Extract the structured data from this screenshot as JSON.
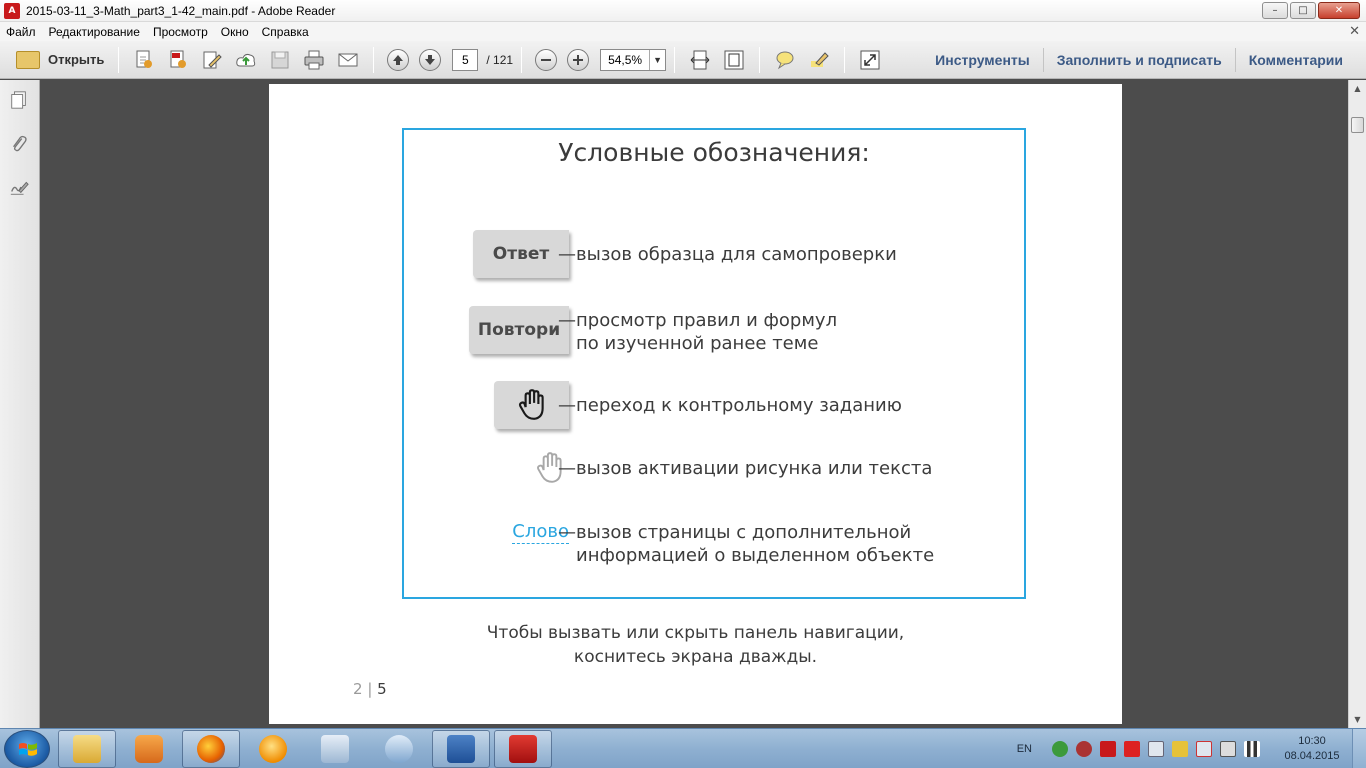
{
  "window": {
    "title": "2015-03-11_3-Math_part3_1-42_main.pdf - Adobe Reader",
    "controls": {
      "minimize": "–",
      "maximize": "□",
      "close": "✕"
    }
  },
  "menubar": {
    "items": [
      "Файл",
      "Редактирование",
      "Просмотр",
      "Окно",
      "Справка"
    ],
    "close_glyph": "✕"
  },
  "toolbar": {
    "open_label": "Открыть",
    "page_current": "5",
    "page_total": "/ 121",
    "zoom": "54,5%",
    "panes": [
      "Инструменты",
      "Заполнить и подписать",
      "Комментарии"
    ]
  },
  "page": {
    "legend_title": "Условные обозначения:",
    "rows": [
      {
        "key": "Ответ",
        "dash": "—",
        "lines": [
          "вызов образца для самопроверки"
        ]
      },
      {
        "key": "Повтори",
        "dash": "—",
        "lines": [
          "просмотр правил и формул",
          "по изученной ранее теме"
        ]
      },
      {
        "key": "hand-dark-icon",
        "dash": "—",
        "lines": [
          "переход к контрольному заданию"
        ]
      },
      {
        "key": "hand-light-icon",
        "dash": "—",
        "lines": [
          "вызов активации рисунка или текста"
        ]
      },
      {
        "key": "Слово",
        "dash": "—",
        "lines": [
          "вызов страницы с дополнительной",
          "информацией о выделенном объекте"
        ]
      }
    ],
    "note_lines": [
      "Чтобы вызвать или скрыть панель навигации,",
      "коснитесь экрана дважды."
    ],
    "page_num_a": "2",
    "page_num_sep": " | ",
    "page_num_b": "5"
  },
  "colors": {
    "accent_blue": "#2aa6e0",
    "pane_link": "#3c5a86",
    "acrobat_red": "#c8191b"
  },
  "taskbar": {
    "language": "EN",
    "time": "10:30",
    "date": "08.04.2015"
  }
}
